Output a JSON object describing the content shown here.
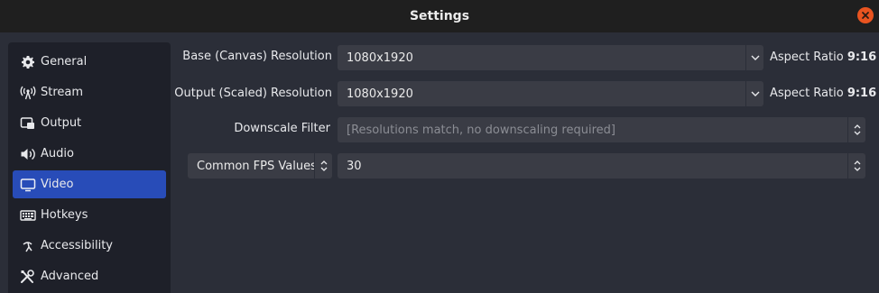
{
  "window": {
    "title": "Settings"
  },
  "sidebar": {
    "items": [
      {
        "label": "General",
        "icon": "gear-icon"
      },
      {
        "label": "Stream",
        "icon": "antenna-icon"
      },
      {
        "label": "Output",
        "icon": "output-icon"
      },
      {
        "label": "Audio",
        "icon": "speaker-icon"
      },
      {
        "label": "Video",
        "icon": "monitor-icon",
        "active": true
      },
      {
        "label": "Hotkeys",
        "icon": "keyboard-icon"
      },
      {
        "label": "Accessibility",
        "icon": "accessibility-icon"
      },
      {
        "label": "Advanced",
        "icon": "tools-icon"
      }
    ]
  },
  "video": {
    "base_resolution": {
      "label": "Base (Canvas) Resolution",
      "value": "1080x1920",
      "aspect_label": "Aspect Ratio",
      "aspect_value": "9:16"
    },
    "output_resolution": {
      "label": "Output (Scaled) Resolution",
      "value": "1080x1920",
      "aspect_label": "Aspect Ratio",
      "aspect_value": "9:16"
    },
    "downscale_filter": {
      "label": "Downscale Filter",
      "value": "[Resolutions match, no downscaling required]"
    },
    "fps": {
      "type_label": "Common FPS Values",
      "value": "30"
    }
  },
  "colors": {
    "accent": "#284cb8",
    "close": "#e95420",
    "background": "#2b2e38",
    "sidebar": "#1e2029",
    "field": "#3a3c45"
  }
}
